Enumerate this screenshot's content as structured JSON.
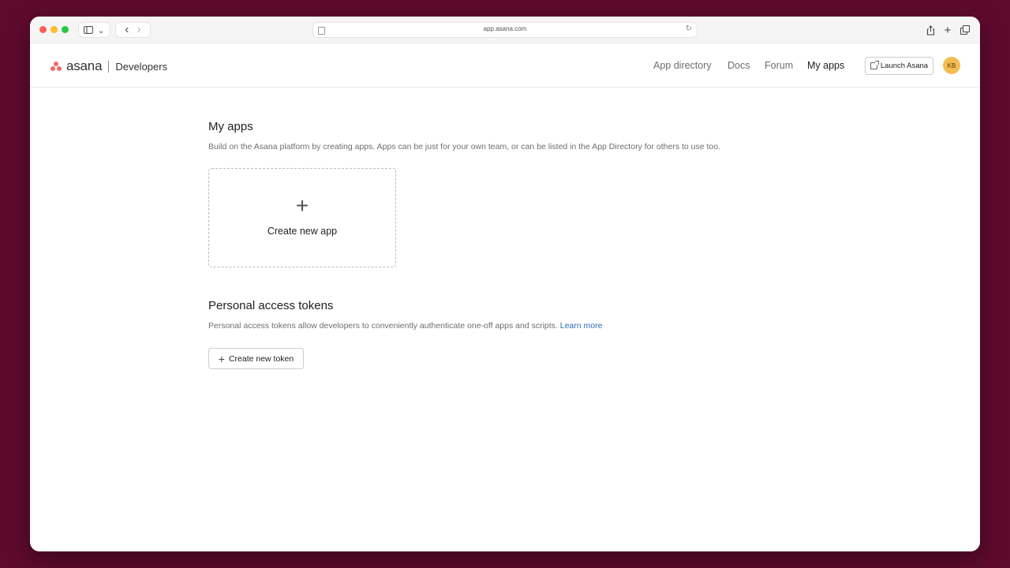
{
  "browser": {
    "url": "app.asana.com",
    "back_glyph": "‹",
    "forward_glyph": "›",
    "sidebar_glyph": "⌄"
  },
  "header": {
    "logo_word": "asana",
    "logo_section": "Developers",
    "nav": {
      "app_directory": "App directory",
      "docs": "Docs",
      "forum": "Forum",
      "my_apps": "My apps"
    },
    "launch_label": "Launch Asana",
    "avatar_initials": "KB"
  },
  "my_apps": {
    "title": "My apps",
    "description": "Build on the Asana platform by creating apps. Apps can be just for your own team, or can be listed in the App Directory for others to use too.",
    "create_label": "Create new app",
    "create_icon": "+"
  },
  "tokens": {
    "title": "Personal access tokens",
    "description": "Personal access tokens allow developers to conveniently authenticate one-off apps and scripts.",
    "learn_more": "Learn more",
    "create_label": "Create new token",
    "create_icon": "+"
  },
  "colors": {
    "background": "#5e0a2e",
    "brand_coral": "#f06a6a",
    "link_blue": "#2c6ab0",
    "avatar_yellow": "#f3bd54"
  },
  "icons": [
    "close-icon",
    "minimize-icon",
    "maximize-icon",
    "sidebar-icon",
    "back-icon",
    "forward-icon",
    "page-icon",
    "reload-icon",
    "share-icon",
    "new-tab-icon",
    "tabs-overview-icon",
    "asana-logo-icon",
    "external-link-icon",
    "plus-icon"
  ]
}
